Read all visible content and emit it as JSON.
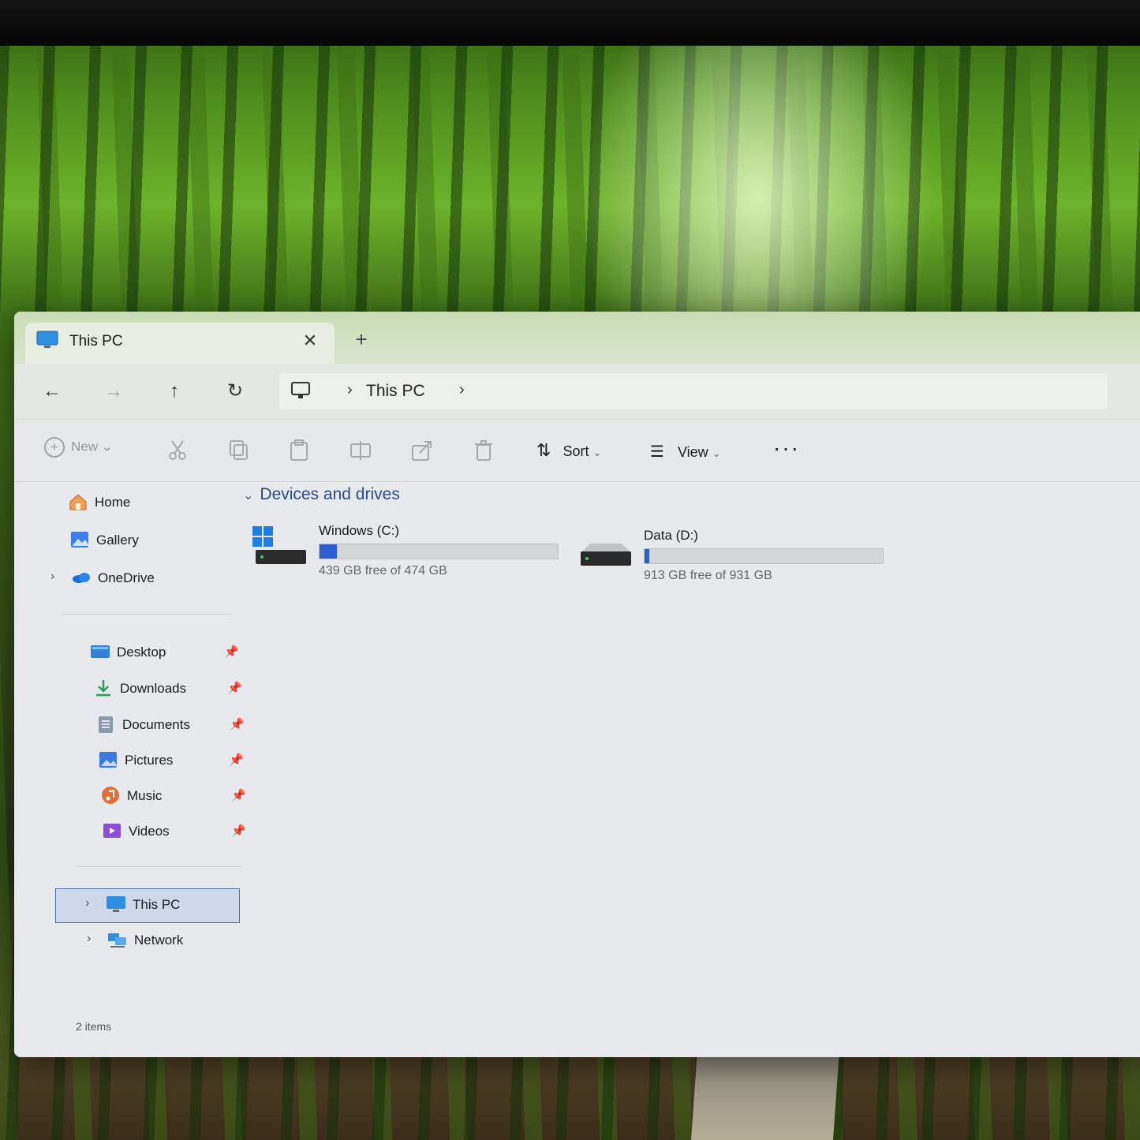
{
  "window": {
    "tab_title": "This PC",
    "new_tab_glyph": "+",
    "close_glyph": "✕"
  },
  "nav": {
    "back": "←",
    "forward": "→",
    "up": "↑",
    "refresh": "↻",
    "chevron": "›",
    "breadcrumb": "This PC"
  },
  "commandbar": {
    "new_label": "New",
    "sort_label": "Sort",
    "view_label": "View",
    "more_label": "···",
    "disabled": [
      "cut-icon",
      "copy-icon",
      "paste-icon",
      "rename-icon",
      "share-icon",
      "delete-icon"
    ]
  },
  "sidebar": {
    "top": [
      {
        "label": "Home",
        "icon": "home-icon"
      },
      {
        "label": "Gallery",
        "icon": "gallery-icon"
      },
      {
        "label": "OneDrive",
        "icon": "onedrive-icon"
      }
    ],
    "quick": [
      {
        "label": "Desktop",
        "icon": "desktop-icon",
        "pinned": true
      },
      {
        "label": "Downloads",
        "icon": "downloads-icon",
        "pinned": true
      },
      {
        "label": "Documents",
        "icon": "documents-icon",
        "pinned": true
      },
      {
        "label": "Pictures",
        "icon": "pictures-icon",
        "pinned": true
      },
      {
        "label": "Music",
        "icon": "music-icon",
        "pinned": true
      },
      {
        "label": "Videos",
        "icon": "videos-icon",
        "pinned": true
      }
    ],
    "bottom": [
      {
        "label": "This PC",
        "icon": "this-pc-icon",
        "selected": true
      },
      {
        "label": "Network",
        "icon": "network-icon"
      }
    ]
  },
  "content": {
    "group_title": "Devices and drives",
    "drives": [
      {
        "name": "Windows (C:)",
        "free_text": "439 GB free of 474 GB",
        "used_fraction": 0.074
      },
      {
        "name": "Data (D:)",
        "free_text": "913 GB free of 931 GB",
        "used_fraction": 0.019
      }
    ]
  },
  "status": {
    "items_text": "2 items"
  },
  "colors": {
    "accent": "#2e5fd0",
    "selection": "#cdd9ea",
    "group_header": "#2a4a8a"
  }
}
